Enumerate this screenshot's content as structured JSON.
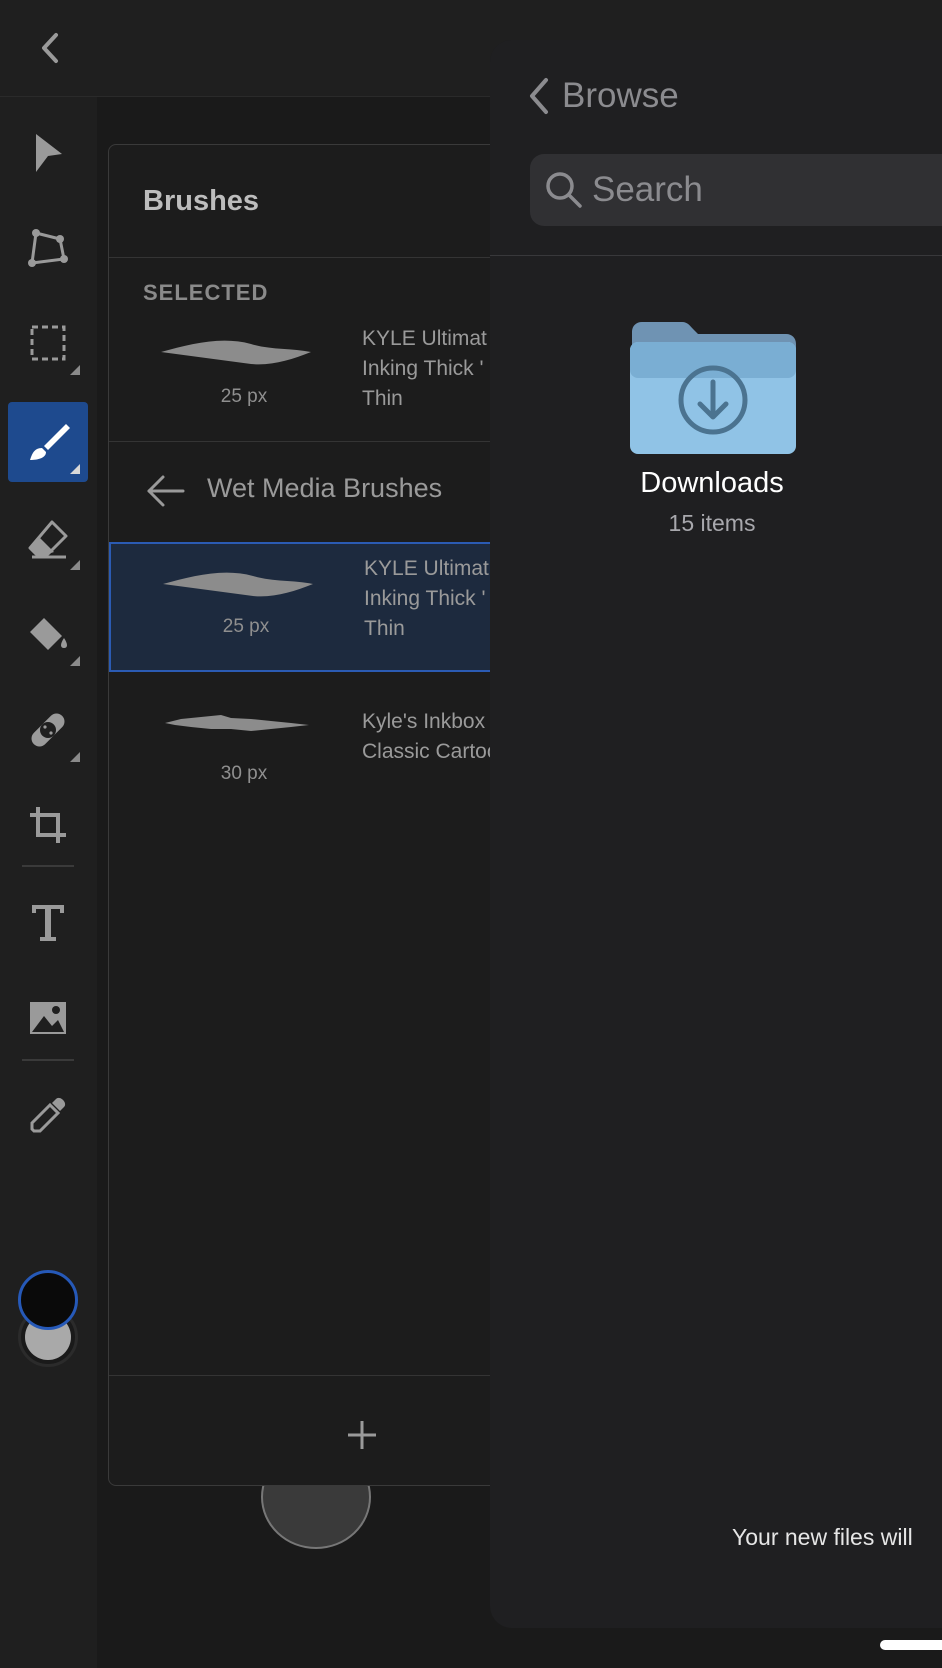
{
  "topbar": {
    "back_icon": "chevron-left-icon"
  },
  "toolbar": {
    "tools": [
      {
        "name": "selection-tool",
        "icon": "arrow-pointer-icon"
      },
      {
        "name": "direct-selection-tool",
        "icon": "anchor-points-icon"
      },
      {
        "name": "marquee-tool",
        "icon": "dashed-rectangle-icon"
      },
      {
        "name": "brush-tool",
        "icon": "paintbrush-icon",
        "active": true
      },
      {
        "name": "eraser-tool",
        "icon": "eraser-icon"
      },
      {
        "name": "fill-tool",
        "icon": "paint-bucket-icon"
      },
      {
        "name": "healing-tool",
        "icon": "bandage-icon"
      },
      {
        "name": "crop-tool",
        "icon": "crop-icon"
      },
      {
        "name": "text-tool",
        "icon": "text-icon"
      },
      {
        "name": "image-tool",
        "icon": "image-icon"
      },
      {
        "name": "eyedropper-tool",
        "icon": "eyedropper-icon"
      }
    ],
    "foreground_color": "#0a0a0a",
    "background_color": "#a9a9a9",
    "accent_color": "#2659b8"
  },
  "brushes_panel": {
    "title": "Brushes",
    "selected_label": "SELECTED",
    "selected_brush": {
      "size": "25 px",
      "name": "KYLE Ultimat\nInking Thick '\nThin"
    },
    "set_name": "Wet Media Brushes",
    "brushes": [
      {
        "size": "25 px",
        "name": "KYLE Ultimat\nInking Thick '\nThin",
        "highlighted": true
      },
      {
        "size": "30 px",
        "name": "Kyle's Inkbox\nClassic Cartoo"
      }
    ],
    "add_icon": "plus-icon"
  },
  "browser": {
    "back_label": "Browse",
    "search_placeholder": "Search",
    "folder": {
      "name": "Downloads",
      "count": "15 items",
      "icon": "download-folder-icon"
    },
    "note": "Your new files will"
  }
}
